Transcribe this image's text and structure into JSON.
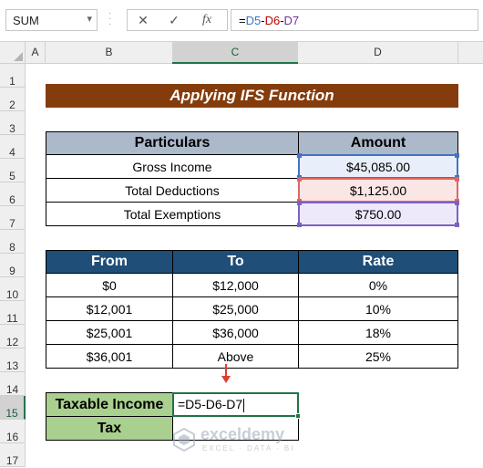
{
  "formula_bar": {
    "name_box": "SUM",
    "cancel_glyph": "✕",
    "enter_glyph": "✓",
    "fx_label": "fx",
    "formula_parts": [
      {
        "text": "=",
        "color": "#000000"
      },
      {
        "text": "D5",
        "color": "#4472c4"
      },
      {
        "text": "-",
        "color": "#000000"
      },
      {
        "text": "D6",
        "color": "#c00000"
      },
      {
        "text": "-",
        "color": "#000000"
      },
      {
        "text": "D7",
        "color": "#7030a0"
      }
    ]
  },
  "columns": [
    "A",
    "B",
    "C",
    "D"
  ],
  "rows": [
    "1",
    "2",
    "3",
    "4",
    "5",
    "6",
    "7",
    "8",
    "9",
    "10",
    "11",
    "12",
    "13",
    "14",
    "15",
    "16",
    "17"
  ],
  "selected_column": "C",
  "selected_row": "15",
  "sheet": {
    "title": "Applying IFS Function",
    "particulars_table": {
      "headers": [
        "Particulars",
        "Amount"
      ],
      "rows": [
        [
          "Gross Income",
          "$45,085.00"
        ],
        [
          "Total Deductions",
          "$1,125.00"
        ],
        [
          "Total Exemptions",
          "$750.00"
        ]
      ]
    },
    "rate_table": {
      "headers": [
        "From",
        "To",
        "Rate"
      ],
      "rows": [
        [
          "$0",
          "$12,000",
          "0%"
        ],
        [
          "$12,001",
          "$25,000",
          "10%"
        ],
        [
          "$25,001",
          "$36,000",
          "18%"
        ],
        [
          "$36,001",
          "Above",
          "25%"
        ]
      ]
    },
    "result": {
      "taxable_label": "Taxable Income",
      "tax_label": "Tax",
      "editing_text": "=D5-D6-D7"
    }
  },
  "watermark": {
    "name": "exceldemy",
    "tagline": "EXCEL · DATA · BI"
  },
  "colors": {
    "title_fill": "#843c0c",
    "particulars_header_fill": "#acb9ca",
    "rate_header_fill": "#1f4e78",
    "label_fill": "#a9d08e",
    "active_border": "#217346",
    "arrow": "#e03c31"
  }
}
